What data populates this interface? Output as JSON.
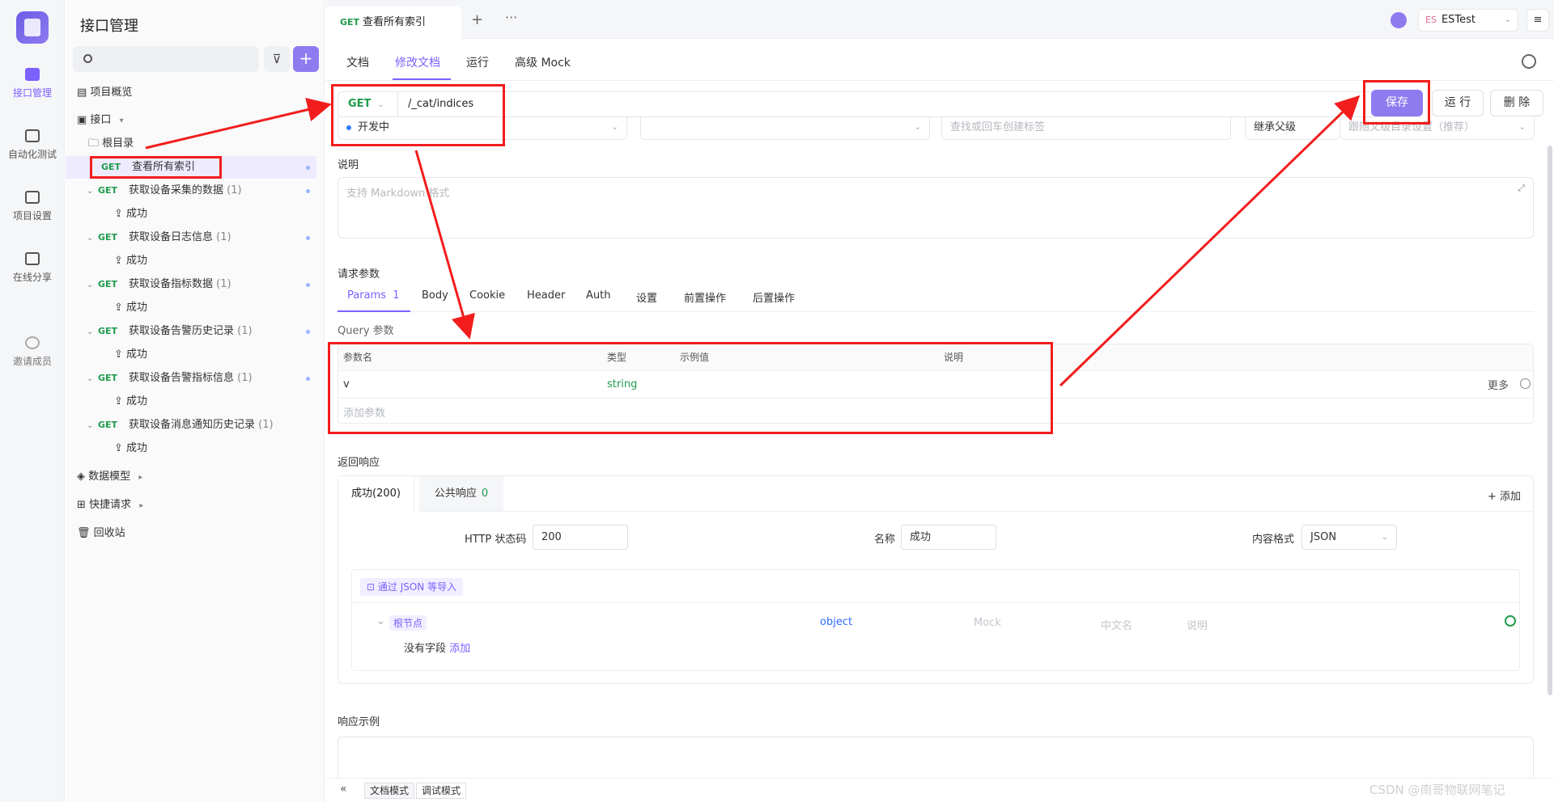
{
  "rail": {
    "items": [
      {
        "label": "接口管理",
        "icon": "api-management-icon"
      },
      {
        "label": "自动化测试",
        "icon": "automation-test-icon"
      },
      {
        "label": "项目设置",
        "icon": "project-settings-icon"
      },
      {
        "label": "在线分享",
        "icon": "online-share-icon"
      },
      {
        "label": "邀请成员",
        "icon": "invite-member-icon"
      }
    ]
  },
  "sidebar": {
    "title": "接口管理",
    "search_placeholder": "",
    "overview": "项目概览",
    "api_folder": "接口",
    "root_dir": "根目录",
    "selected": {
      "method": "GET",
      "name": "查看所有索引"
    },
    "endpoints": [
      {
        "method": "GET",
        "name": "获取设备采集的数据",
        "count": "(1)",
        "case": "成功"
      },
      {
        "method": "GET",
        "name": "获取设备日志信息",
        "count": "(1)",
        "case": "成功"
      },
      {
        "method": "GET",
        "name": "获取设备指标数据",
        "count": "(1)",
        "case": "成功"
      },
      {
        "method": "GET",
        "name": "获取设备告警历史记录",
        "count": "(1)",
        "case": "成功"
      },
      {
        "method": "GET",
        "name": "获取设备告警指标信息",
        "count": "(1)",
        "case": "成功"
      },
      {
        "method": "GET",
        "name": "获取设备消息通知历史记录",
        "count": "(1)",
        "case": "成功"
      }
    ],
    "data_model": "数据模型",
    "quick_request": "快捷请求",
    "recycle_bin": "回收站"
  },
  "topbar": {
    "tab": {
      "method": "GET",
      "title": "查看所有索引"
    },
    "plus": "+",
    "more": "···",
    "workspace_prefix": "ES",
    "workspace": "ESTest",
    "menu": "≡"
  },
  "subtabs": [
    "文档",
    "修改文档",
    "运行",
    "高级 Mock"
  ],
  "request": {
    "method": "GET",
    "path": "/_cat/indices",
    "status": "开发中",
    "tag_placeholder": "查找或回车创建标签",
    "inherit_label": "继承父级",
    "inherit_value": "跟随父级目录设置（推荐）"
  },
  "actions": {
    "save": "保存",
    "run": "运 行",
    "delete": "删 除"
  },
  "description": {
    "label": "说明",
    "placeholder": "支持 Markdown 格式"
  },
  "params": {
    "section_label": "请求参数",
    "tabs": [
      {
        "label": "Params",
        "badge": "1"
      },
      {
        "label": "Body"
      },
      {
        "label": "Cookie"
      },
      {
        "label": "Header"
      },
      {
        "label": "Auth"
      },
      {
        "label": "设置"
      },
      {
        "label": "前置操作"
      },
      {
        "label": "后置操作"
      }
    ],
    "query_label": "Query 参数",
    "columns": [
      "参数名",
      "类型",
      "示例值",
      "说明"
    ],
    "rows": [
      {
        "name": "v",
        "type": "string",
        "example": "",
        "desc": ""
      }
    ],
    "add_placeholder": "添加参数",
    "more": "更多"
  },
  "response": {
    "section_label": "返回响应",
    "tabs": [
      {
        "label": "成功(200)"
      },
      {
        "label": "公共响应",
        "badge": "0"
      }
    ],
    "add": "+ 添加",
    "http_status_label": "HTTP 状态码",
    "http_status": "200",
    "name_label": "名称",
    "name": "成功",
    "format_label": "内容格式",
    "format": "JSON",
    "import_btn": "通过 JSON 等导入",
    "root_node": "根节点",
    "root_type": "object",
    "mock_ph": "Mock",
    "cn_name_ph": "中文名",
    "desc_ph": "说明",
    "no_field": "没有字段",
    "add_link": "添加"
  },
  "example": {
    "label": "响应示例"
  },
  "footer": {
    "collapse": "«",
    "doc_mode": "文档模式",
    "debug_mode": "调试模式",
    "watermark": "CSDN @南哥物联网笔记"
  },
  "colors": {
    "accent": "#7b61ff",
    "get": "#1e9b4b",
    "annotation": "#f21d1d"
  }
}
